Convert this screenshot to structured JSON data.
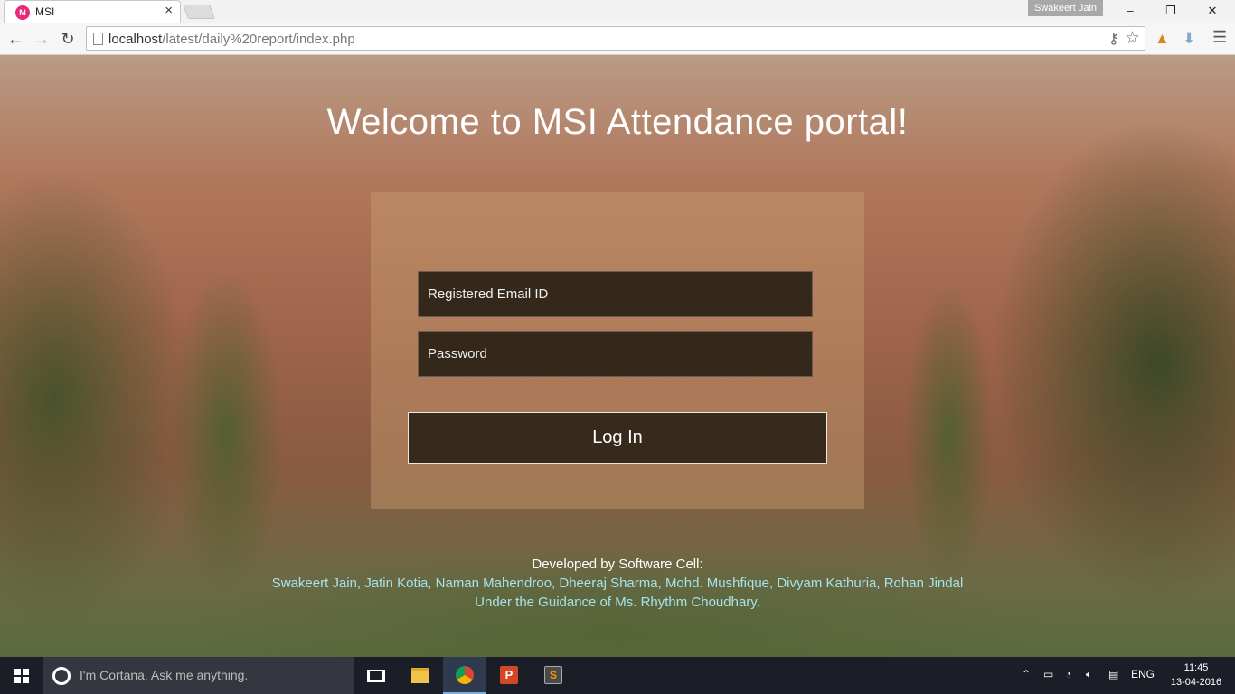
{
  "browser": {
    "tab_title": "MSI",
    "tab_favicon": "M",
    "profile_name": "Swakeert Jain",
    "url_host": "localhost",
    "url_path": "/latest/daily%20report/index.php"
  },
  "page": {
    "heading": "Welcome to MSI Attendance portal!",
    "email_placeholder": "Registered Email ID",
    "password_placeholder": "Password",
    "login_label": "Log In",
    "credits_title": "Developed by Software Cell:",
    "credits_names": "Swakeert Jain, Jatin Kotia, Naman Mahendroo, Dheeraj Sharma, Mohd. Mushfique, Divyam Kathuria, Rohan Jindal",
    "credits_guidance": "Under the Guidance of Ms. Rhythm Choudhary."
  },
  "taskbar": {
    "cortana_placeholder": "I'm Cortana. Ask me anything.",
    "language": "ENG",
    "time": "11:45",
    "date": "13-04-2016"
  },
  "colors": {
    "credits_accent": "#a7e2ea",
    "taskbar": "#1b1e27",
    "favicon": "#e8287a"
  }
}
